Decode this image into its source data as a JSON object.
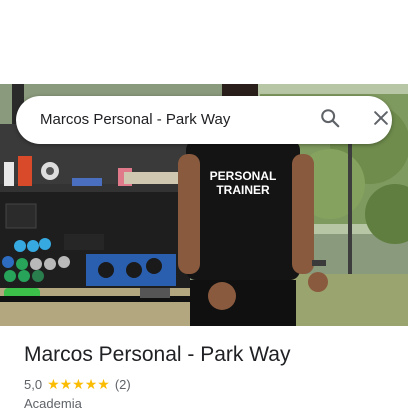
{
  "search": {
    "query": "Marcos Personal - Park Way"
  },
  "photo": {
    "shirt_text_line1": "PERSONAL",
    "shirt_text_line2": "TRAINER"
  },
  "place": {
    "title": "Marcos Personal - Park Way",
    "rating": "5,0",
    "stars": "★★★★★",
    "review_count": "(2)",
    "category": "Academia"
  },
  "icons": {
    "search": "search-icon",
    "close": "close-icon",
    "star": "star-icon"
  },
  "colors": {
    "star": "#fbbc04",
    "title_text": "#202124",
    "secondary_text": "#5f6368",
    "search_icon": "#5f6368"
  }
}
